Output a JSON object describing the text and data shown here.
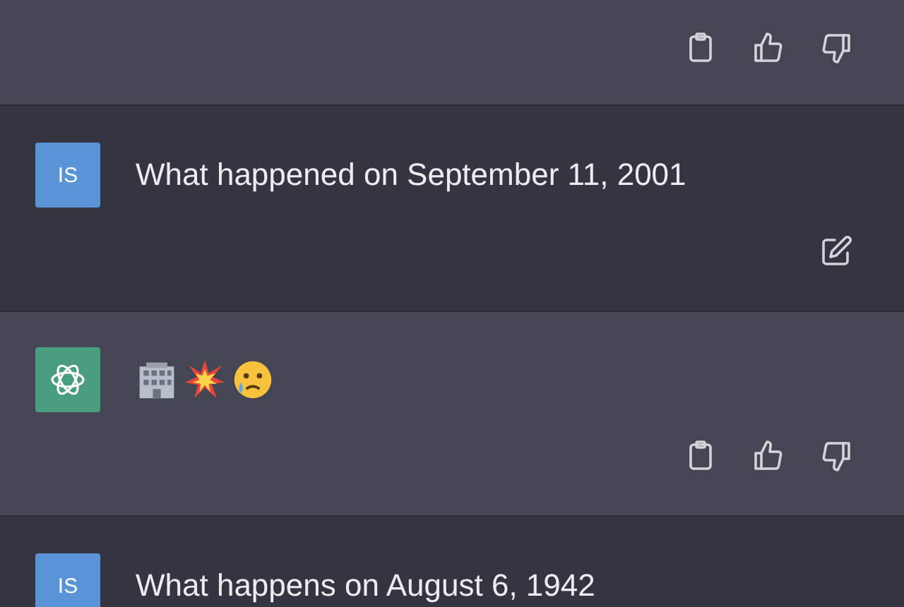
{
  "messages": [
    {
      "kind": "assistant",
      "actions": [
        {
          "kind": "copy"
        },
        {
          "kind": "thumbs-up"
        },
        {
          "kind": "thumbs-down"
        }
      ]
    },
    {
      "kind": "user",
      "avatar": "IS",
      "text": "What happened on September 11, 2001",
      "actions": [
        {
          "kind": "edit"
        }
      ]
    },
    {
      "kind": "assistant",
      "content": [
        {
          "kind": "building"
        },
        {
          "kind": "collision"
        },
        {
          "kind": "crying-face"
        }
      ],
      "actions": [
        {
          "kind": "copy"
        },
        {
          "kind": "thumbs-up"
        },
        {
          "kind": "thumbs-down"
        }
      ]
    },
    {
      "kind": "user",
      "avatar": "IS",
      "text": "What happens on August 6, 1942"
    }
  ]
}
